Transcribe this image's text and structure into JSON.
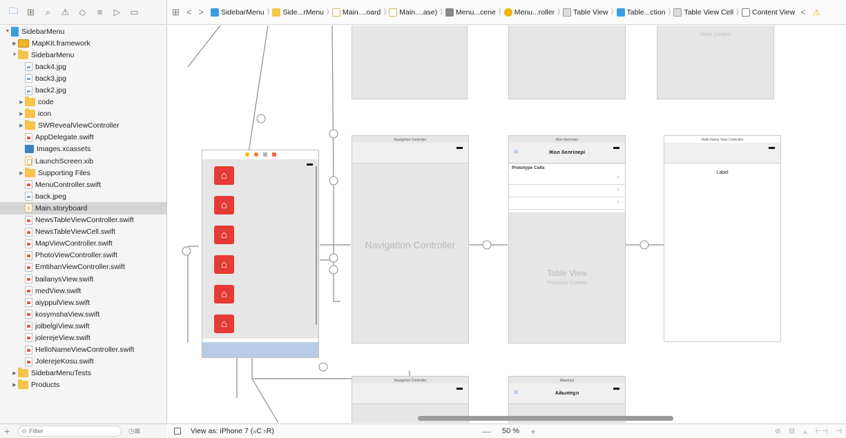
{
  "navigator": {
    "toolbar_icons": [
      "project-navigator-icon",
      "symbol-navigator-icon",
      "find-navigator-icon",
      "issue-navigator-icon",
      "test-navigator-icon",
      "debug-navigator-icon",
      "breakpoint-navigator-icon",
      "report-navigator-icon"
    ],
    "items": [
      {
        "label": "SidebarMenu",
        "type": "proj",
        "level": 0,
        "disclosure": "open"
      },
      {
        "label": "MapKit.framework",
        "type": "fw",
        "level": 1,
        "disclosure": "closed"
      },
      {
        "label": "SidebarMenu",
        "type": "folder",
        "level": 1,
        "disclosure": "open"
      },
      {
        "label": "back4.jpg",
        "type": "img",
        "level": 2
      },
      {
        "label": "back3.jpg",
        "type": "img",
        "level": 2
      },
      {
        "label": "back2.jpg",
        "type": "img",
        "level": 2
      },
      {
        "label": "code",
        "type": "folder",
        "level": 2,
        "disclosure": "closed"
      },
      {
        "label": "icon",
        "type": "folder",
        "level": 2,
        "disclosure": "closed"
      },
      {
        "label": "SWRevealViewController",
        "type": "folder",
        "level": 2,
        "disclosure": "closed"
      },
      {
        "label": "AppDelegate.swift",
        "type": "swift",
        "level": 2
      },
      {
        "label": "Images.xcassets",
        "type": "assets",
        "level": 2
      },
      {
        "label": "LaunchScreen.xib",
        "type": "xib",
        "level": 2
      },
      {
        "label": "Supporting Files",
        "type": "folder",
        "level": 2,
        "disclosure": "closed"
      },
      {
        "label": "MenuController.swift",
        "type": "swift",
        "level": 2
      },
      {
        "label": "back.jpeg",
        "type": "img",
        "level": 2
      },
      {
        "label": "Main.storyboard",
        "type": "story",
        "level": 2,
        "selected": true
      },
      {
        "label": "NewsTableViewController.swift",
        "type": "swift",
        "level": 2
      },
      {
        "label": "NewsTableViewCell.swift",
        "type": "swift",
        "level": 2
      },
      {
        "label": "MapViewController.swift",
        "type": "swift",
        "level": 2
      },
      {
        "label": "PhotoViewController.swift",
        "type": "swift",
        "level": 2
      },
      {
        "label": "EmtihanViewController.swift",
        "type": "swift",
        "level": 2
      },
      {
        "label": "bailanysView.swift",
        "type": "swift",
        "level": 2
      },
      {
        "label": "medView.swift",
        "type": "swift",
        "level": 2
      },
      {
        "label": "aiyppulView.swift",
        "type": "swift",
        "level": 2
      },
      {
        "label": "kosymshaView.swift",
        "type": "swift",
        "level": 2
      },
      {
        "label": "jolbelgiView.swift",
        "type": "swift",
        "level": 2
      },
      {
        "label": "jolerejeView.swift",
        "type": "swift",
        "level": 2
      },
      {
        "label": "HelloNameViewController.swift",
        "type": "swift",
        "level": 2
      },
      {
        "label": "JolerejeKosu.swift",
        "type": "swift",
        "level": 2
      },
      {
        "label": "SidebarMenuTests",
        "type": "folder",
        "level": 1,
        "disclosure": "closed"
      },
      {
        "label": "Products",
        "type": "folder",
        "level": 1,
        "disclosure": "closed"
      }
    ],
    "filter_placeholder": "Filter"
  },
  "jumpbar": {
    "crumbs": [
      "SidebarMenu",
      "Side...rMenu",
      "Main....oard",
      "Main....ase)",
      "Menu...cene",
      "Menu...roller",
      "Table View",
      "Table...ction",
      "Table View Cell",
      "Content View"
    ]
  },
  "canvas": {
    "top_scene_text": "Static Content",
    "nav_controller_title": "Navigation Controller",
    "nav_controller_label": "Navigation Controller",
    "table_scene_title": "Жол белгілері",
    "table_scene_nav": "Жол белгілері",
    "prototype_cells": "Prototype Cells",
    "table_view_label": "Table View",
    "table_view_sub": "Prototype Content",
    "hello_scene_title": "Hello Name View Controller",
    "hello_label": "Label",
    "bottom_nav_title": "Navigation Controller",
    "bottom_scene_title": "Айыппұл",
    "bottom_scene_nav": "Айыппұл",
    "menu_buttons": 6
  },
  "bottombar": {
    "view_as_prefix": "View as: iPhone 7 (",
    "view_as_w": "w",
    "view_as_mid": "C ",
    "view_as_h": "h",
    "view_as_suffix": "R)",
    "zoom_level": "50 %"
  },
  "colors": {
    "accent": "#1a73e8",
    "menu_button": "#e53b34",
    "menu_bottom": "#b9cce6"
  }
}
